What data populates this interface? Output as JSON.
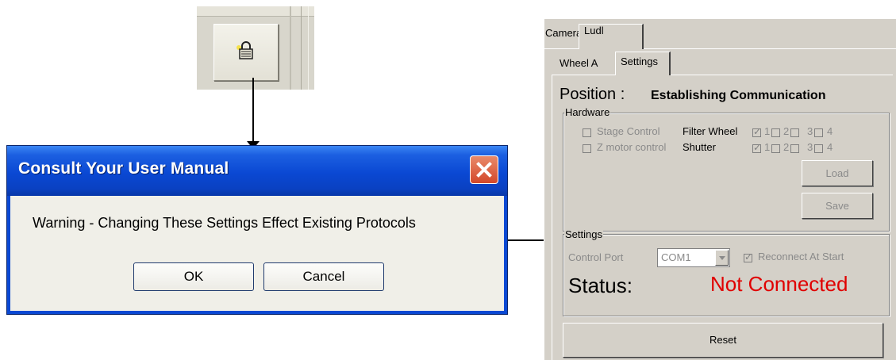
{
  "lock_button": {
    "icon": "lock-icon"
  },
  "dialog": {
    "title": "Consult Your User Manual",
    "message": "Warning - Changing These Settings Effect Existing Protocols",
    "ok_label": "OK",
    "cancel_label": "Cancel",
    "title_color": "#0a48d3"
  },
  "panel": {
    "tabs": [
      "Camera",
      "Ludl"
    ],
    "subtabs": [
      "Wheel A",
      "Settings"
    ],
    "position_label": "Position :",
    "position_status": "Establishing Communication",
    "hardware": {
      "group_label": "Hardware",
      "stage_control": "Stage Control",
      "z_motor_control": "Z motor control",
      "filter_wheel_label": "Filter Wheel",
      "shutter_label": "Shutter",
      "numbers": [
        "1",
        "2",
        "3",
        "4"
      ],
      "load_label": "Load",
      "save_label": "Save"
    },
    "settings": {
      "group_label": "Settings",
      "control_port_label": "Control Port",
      "control_port_value": "COM1",
      "reconnect_label": "Reconnect At Start",
      "status_label": "Status:",
      "status_value": "Not Connected",
      "status_color": "#e00000"
    },
    "reset_label": "Reset"
  }
}
